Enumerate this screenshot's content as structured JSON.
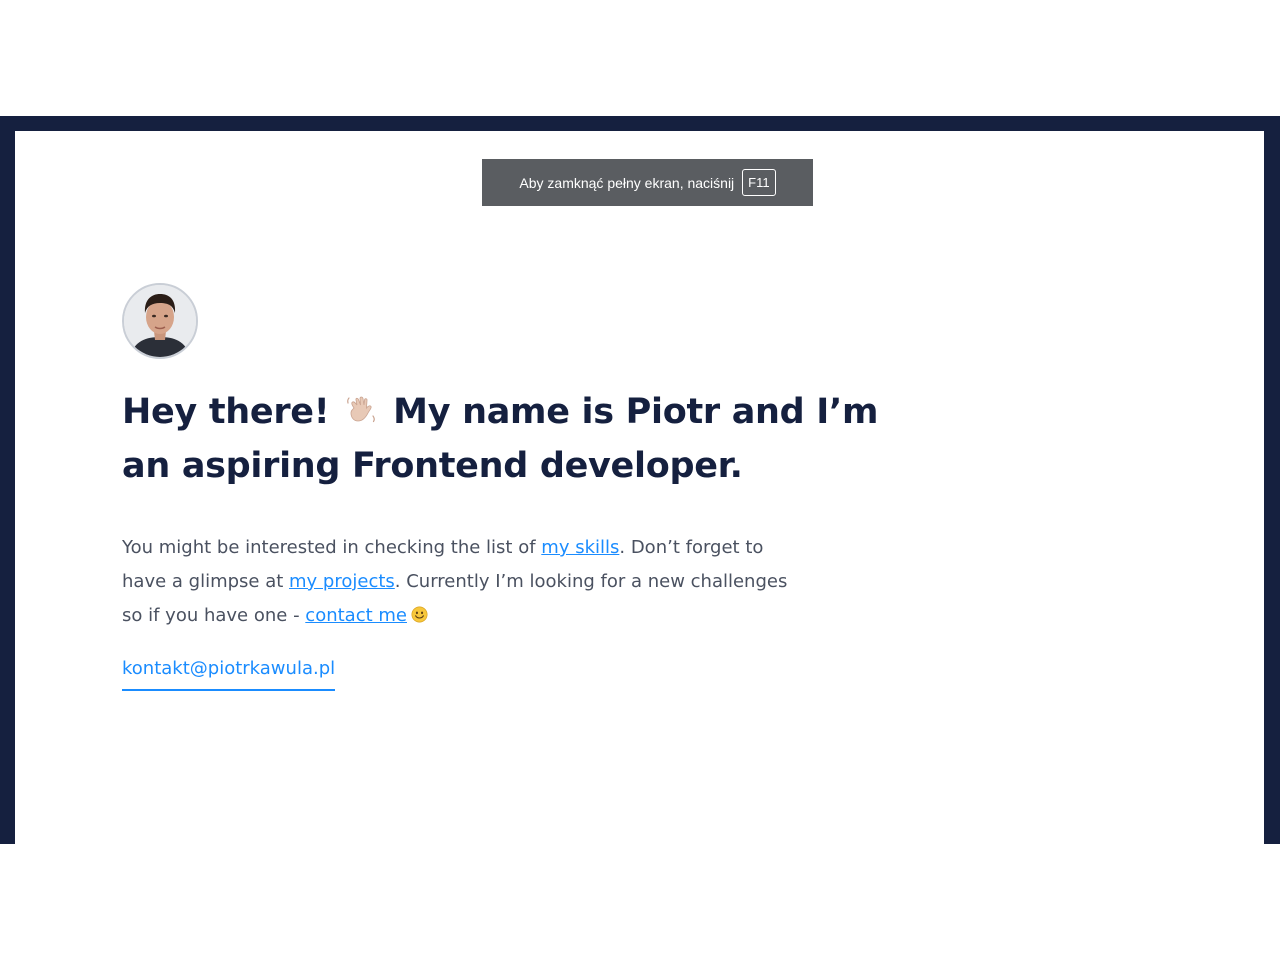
{
  "fullscreen_notice": {
    "text": "Aby zamknąć pełny ekran, naciśnij",
    "key": "F11"
  },
  "profile": {
    "avatar_icon": "person-photo-icon"
  },
  "headline": {
    "part1": "Hey there!",
    "wave_icon": "waving-hand-icon",
    "part2": "My name is Piotr and I’m an aspiring Frontend developer."
  },
  "intro": {
    "t1": "You might be interested in checking the list of ",
    "skills_link": "my skills",
    "t2": ". Don’t forget to have a glimpse at ",
    "projects_link": "my projects",
    "t3": ". Currently I’m looking for a new challenges so if you have one - ",
    "contact_link": "contact me",
    "smile_icon": "smiling-face-icon"
  },
  "email": "kontakt@piotrkawula.pl",
  "colors": {
    "frame": "#15203f",
    "heading": "#15203f",
    "body_text": "#4a5160",
    "link": "#1a8cff",
    "toast_bg": "#5a5d61"
  }
}
